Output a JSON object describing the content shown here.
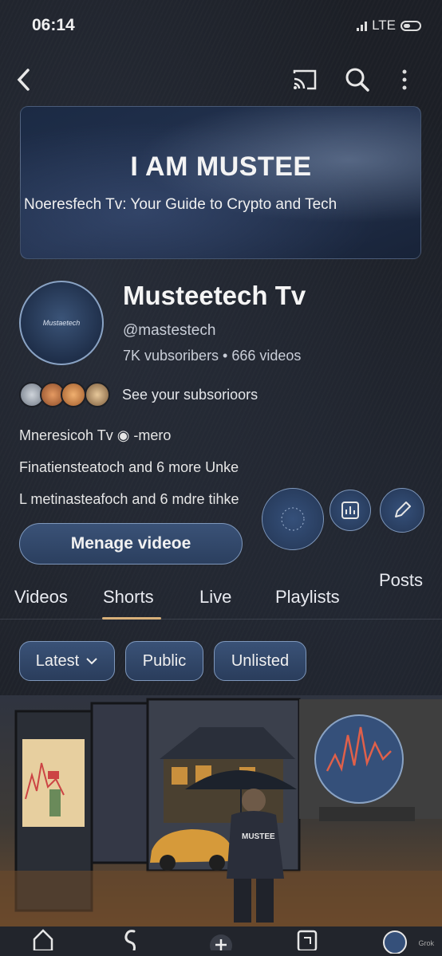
{
  "status_bar": {
    "time": "06:14",
    "network": "LTE"
  },
  "banner": {
    "title": "I AM MUSTEE",
    "subtitle": "Noeresfech Tv: Your Guide to Crypto and Tech"
  },
  "channel": {
    "avatar_text": "Mustaetech",
    "name": "Musteetech Tv",
    "handle": "@mastestech",
    "stats": "7K vubsoribers • 666 videos",
    "see_subscribers": "See your subsorioors",
    "collab_lines": [
      "Mneresicoh Tv ◉ -mero",
      "Finatiensteatoch and 6 more Unke",
      "L metinasteafoch and 6 mdre tihke"
    ]
  },
  "actions": {
    "manage_label": "Menage videoe"
  },
  "tabs": [
    {
      "label": "Videos"
    },
    {
      "label": "Shorts"
    },
    {
      "label": "Live"
    },
    {
      "label": "Playlists"
    },
    {
      "label": "Posts"
    }
  ],
  "active_tab": "Shorts",
  "filters": [
    {
      "label": "Latest",
      "has_dropdown": true
    },
    {
      "label": "Public"
    },
    {
      "label": "Unlisted"
    }
  ],
  "video_thumbnail": {
    "jacket_text": "MUSTEE"
  },
  "watermark": "Grok",
  "colors": {
    "accent": "#d8b07a",
    "chip_fill": "#3a5277",
    "chip_border": "#7e97bb",
    "background": "#1c1f26"
  }
}
